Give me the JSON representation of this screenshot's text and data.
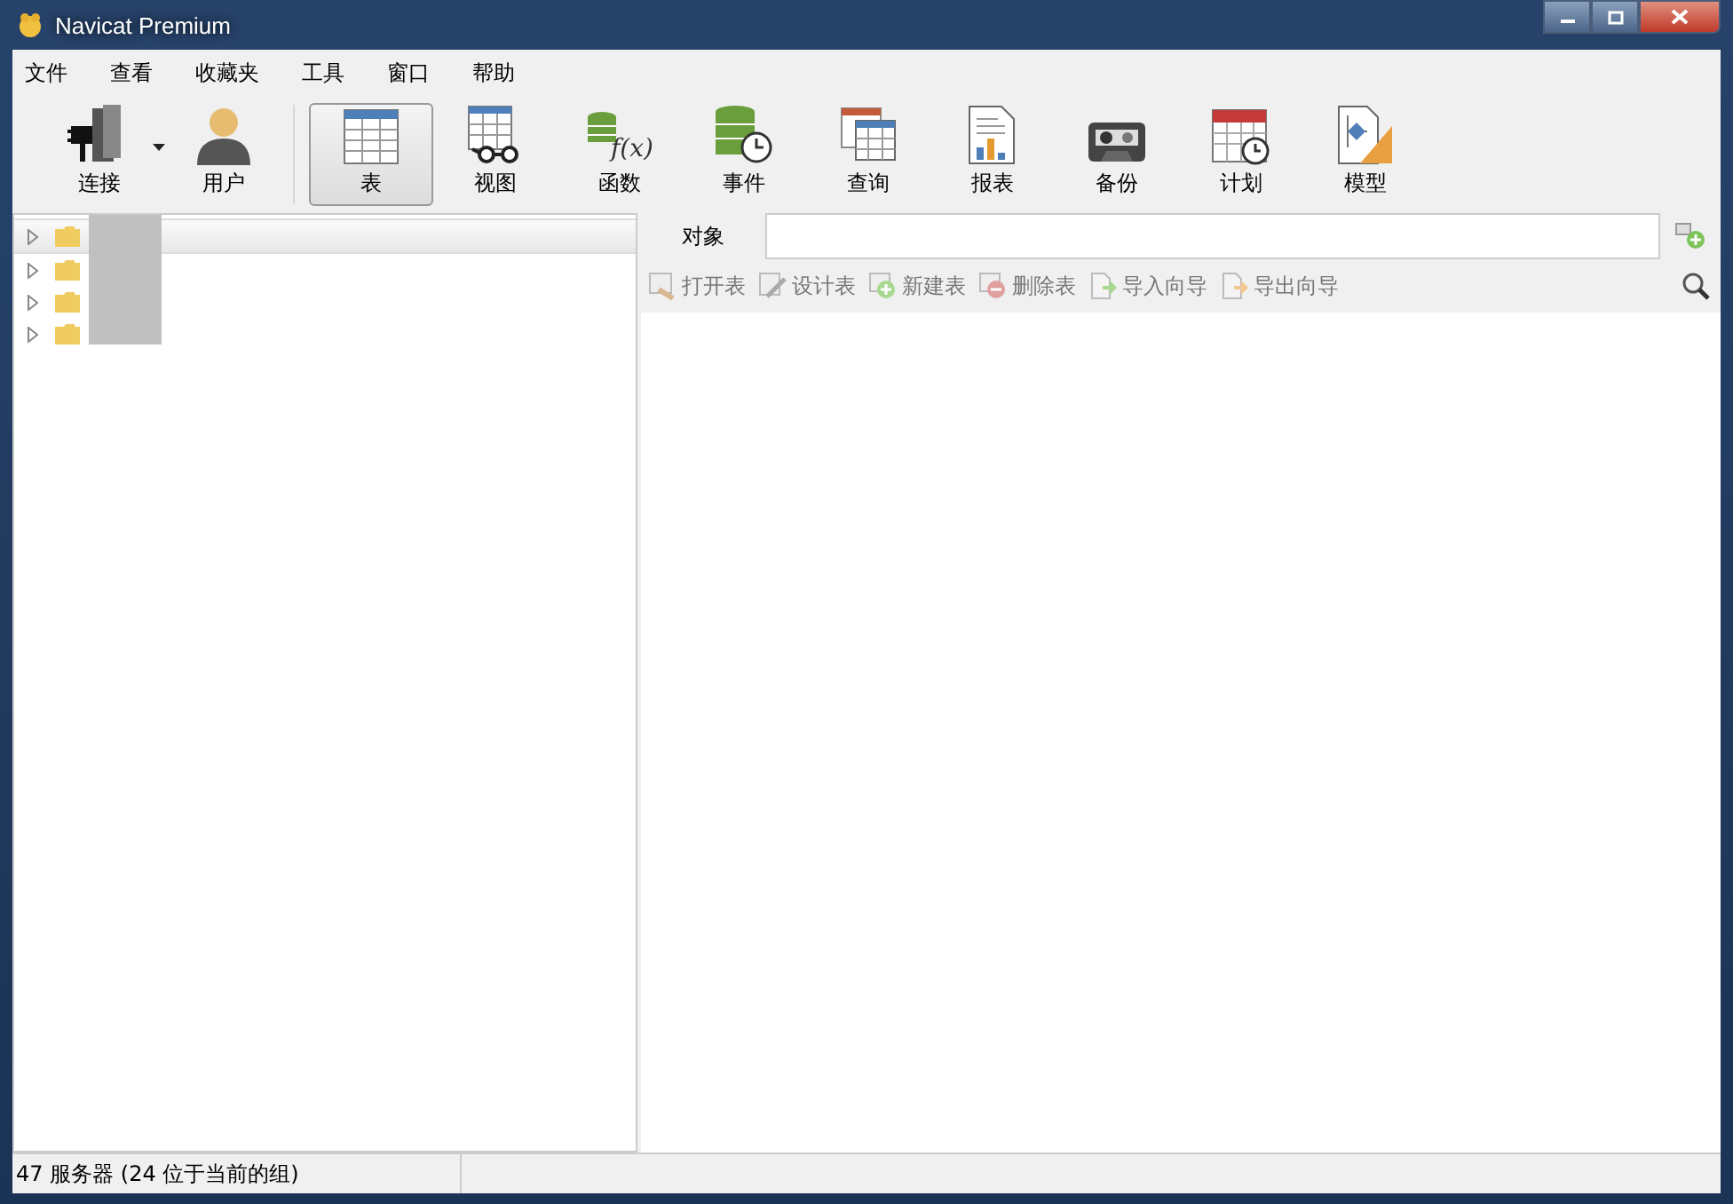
{
  "window": {
    "title": "Navicat Premium"
  },
  "menu": [
    "文件",
    "查看",
    "收藏夹",
    "工具",
    "窗口",
    "帮助"
  ],
  "toolbar": [
    {
      "label": "连接",
      "kind": "connect",
      "selected": false,
      "dropdown": true
    },
    {
      "label": "用户",
      "kind": "user",
      "selected": false,
      "dropdown": false
    },
    {
      "label": "表",
      "kind": "table",
      "selected": true,
      "dropdown": false
    },
    {
      "label": "视图",
      "kind": "view",
      "selected": false,
      "dropdown": false
    },
    {
      "label": "函数",
      "kind": "function",
      "selected": false,
      "dropdown": false,
      "glyph": "f(x)"
    },
    {
      "label": "事件",
      "kind": "event",
      "selected": false,
      "dropdown": false
    },
    {
      "label": "查询",
      "kind": "query",
      "selected": false,
      "dropdown": false
    },
    {
      "label": "报表",
      "kind": "report",
      "selected": false,
      "dropdown": false
    },
    {
      "label": "备份",
      "kind": "backup",
      "selected": false,
      "dropdown": false
    },
    {
      "label": "计划",
      "kind": "schedule",
      "selected": false,
      "dropdown": false
    },
    {
      "label": "模型",
      "kind": "model",
      "selected": false,
      "dropdown": false
    }
  ],
  "tree": [
    {
      "selected": true,
      "expanded": false
    },
    {
      "selected": false,
      "expanded": false
    },
    {
      "selected": false,
      "expanded": false
    },
    {
      "selected": false,
      "expanded": false
    }
  ],
  "object_tab": {
    "label": "对象"
  },
  "actions": [
    {
      "label": "打开表",
      "kind": "open",
      "disabled": true
    },
    {
      "label": "设计表",
      "kind": "design",
      "disabled": true
    },
    {
      "label": "新建表",
      "kind": "new",
      "disabled": true
    },
    {
      "label": "删除表",
      "kind": "delete",
      "disabled": true
    },
    {
      "label": "导入向导",
      "kind": "import",
      "disabled": true
    },
    {
      "label": "导出向导",
      "kind": "export",
      "disabled": true
    }
  ],
  "status_bar": "47 服务器 (24 位于当前的组)"
}
